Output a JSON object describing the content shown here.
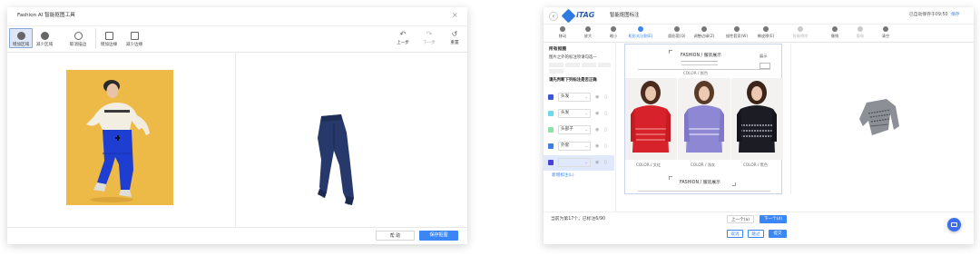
{
  "win1": {
    "title": "Fashion AI 智能抠图工具",
    "close": "×",
    "tools": [
      {
        "label": "增加区域"
      },
      {
        "label": "减少区域"
      },
      {
        "label": "取消描边"
      },
      {
        "label": "增加边缘"
      },
      {
        "label": "减少边缘"
      }
    ],
    "history": [
      {
        "label": "上一步",
        "glyph": "↶"
      },
      {
        "label": "下一步",
        "glyph": "↷"
      },
      {
        "label": "重置",
        "glyph": "↺"
      }
    ],
    "help_label": "帮 助",
    "save_label": "保存抠图"
  },
  "win2": {
    "back": "‹",
    "logo": "iTAG",
    "title": "智能抠图标注",
    "autosave": "已自动保存于09:50",
    "autosave_link": "保存",
    "tools": [
      {
        "label": "移动"
      },
      {
        "label": "放大"
      },
      {
        "label": "缩小"
      },
      {
        "label": "矩形式分割(E)"
      },
      {
        "label": "圆形套(Q)"
      },
      {
        "label": "调整边缘(Z)"
      },
      {
        "label": "描性套索(W)"
      },
      {
        "label": "橡皮擦(E)"
      },
      {
        "label": "智能擦除"
      },
      {
        "label": "撤销"
      },
      {
        "label": "重做"
      },
      {
        "label": "清空"
      }
    ],
    "side": {
      "heading1": "所有抠图",
      "heading2": "图片之外的标注项请勾选一",
      "heading3": "请先判断下列标注是否正确",
      "rows": [
        {
          "label": "头发",
          "color": "#3b57d8"
        },
        {
          "label": "头发",
          "color": "#6fd7e6"
        },
        {
          "label": "头部子",
          "color": "#8ee2a8"
        },
        {
          "label": "外套",
          "color": "#3e7de8"
        },
        {
          "label": "",
          "color": "#4a3fd8"
        }
      ],
      "add_link": "新增标注(L)"
    },
    "doc": {
      "header": "FASHION / 服装展示",
      "header_sub": "展示",
      "caption": "COLOR / 颜色",
      "footer": "FASHION / 服装展示",
      "labels": [
        "COLOR / 文红",
        "COLOR / 浅灰",
        "COLOR / 黑色"
      ]
    },
    "status": "当前为第17个，已标注6/90",
    "prev_label": "上一个(a)",
    "next_label": "下一个(d)",
    "bottom": [
      "取消",
      "跳过",
      "提交"
    ]
  }
}
